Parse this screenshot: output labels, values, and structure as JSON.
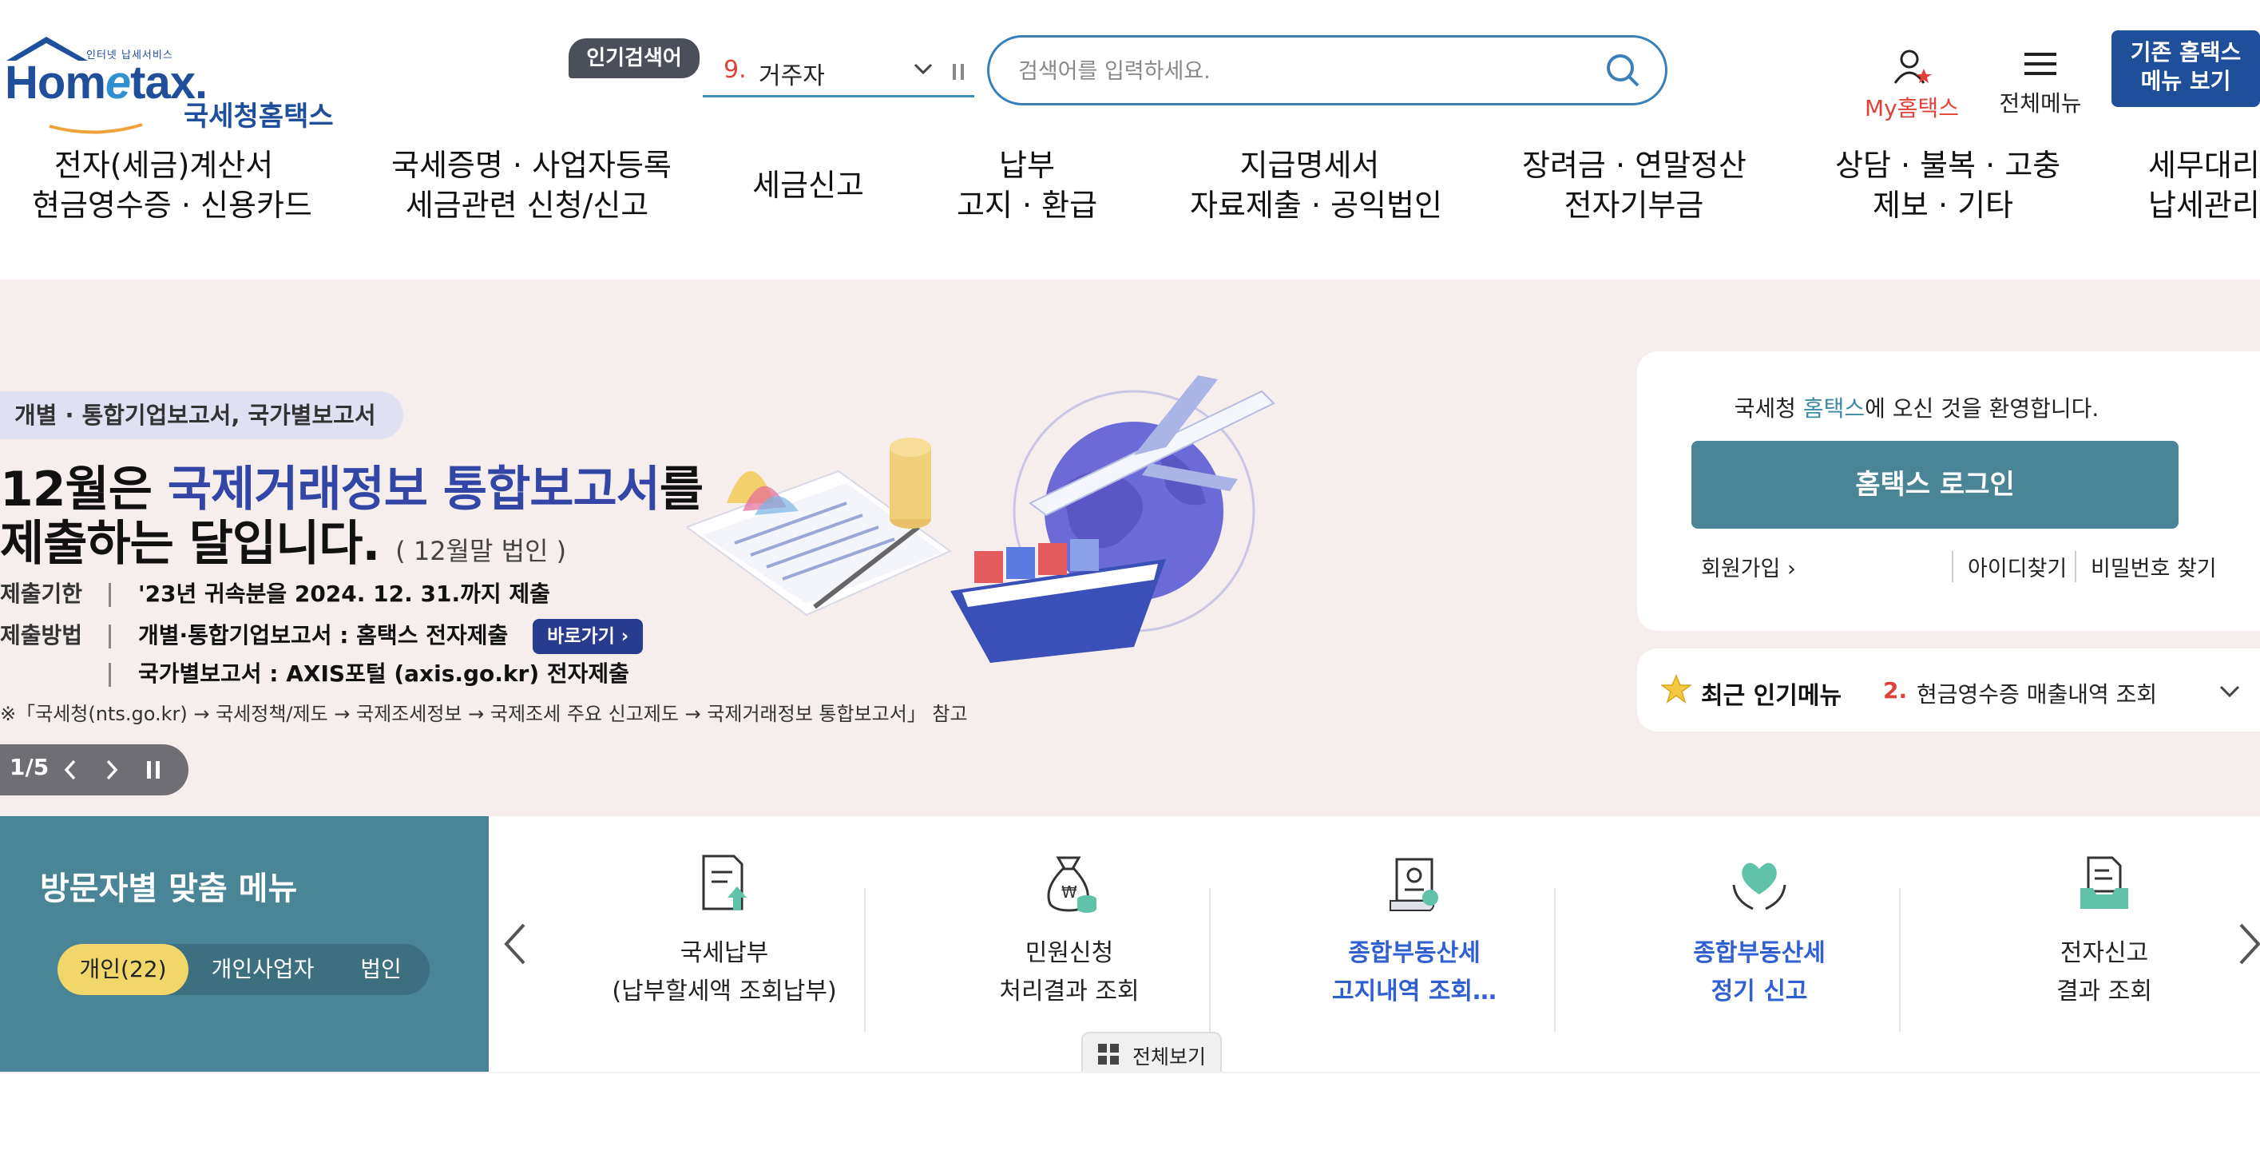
{
  "header": {
    "logo": {
      "small_text": "인터넷 납세서비스",
      "brand_prefix": "Hom",
      "brand_e": "e",
      "brand_suffix": "tax.",
      "korean_name": "국세청홈택스"
    },
    "popular_search": {
      "badge": "인기검색어",
      "rank": "9.",
      "term": "거주자"
    },
    "search": {
      "placeholder": "검색어를 입력하세요."
    },
    "my_hometax_label": "My홈택스",
    "all_menu_label": "전체메뉴",
    "legacy_menu_button": {
      "line1": "기존 홈택스",
      "line2": "메뉴 보기"
    },
    "accent_color": "#1f4e9a"
  },
  "nav": {
    "items": [
      {
        "line1": "전자(세금)계산서",
        "line2": "현금영수증 · 신용카드"
      },
      {
        "line1": "국세증명 · 사업자등록",
        "line2": "세금관련 신청/신고"
      },
      {
        "line1": "세금신고",
        "line2": ""
      },
      {
        "line1": "납부",
        "line2": "고지 · 환급"
      },
      {
        "line1": "지급명세서",
        "line2": "자료제출 · 공익법인"
      },
      {
        "line1": "장려금 · 연말정산",
        "line2": "전자기부금"
      },
      {
        "line1": "상담 · 불복 · 고충",
        "line2": "제보 · 기타"
      },
      {
        "line1": "세무대리",
        "line2": "납세관리"
      }
    ]
  },
  "banner": {
    "tag": "개별 · 통합기업보고서, 국가별보고서",
    "headline1_pre": "12월은 ",
    "headline1_hl": "국제거래정보 통합보고서",
    "headline1_post": "를",
    "headline2": "제출하는 달입니다.",
    "headline2_sub": "( 12월말 법인 )",
    "rows": [
      {
        "key": "제출기한",
        "value": "'23년 귀속분을 2024. 12. 31.까지 제출"
      },
      {
        "key": "제출방법",
        "value": "개별·통합기업보고서 : 홈택스 전자제출"
      },
      {
        "key": "",
        "value": "국가별보고서 : AXIS포털 (axis.go.kr) 전자제출"
      }
    ],
    "go_button": "바로가기",
    "note": "※「국세청(nts.go.kr) → 국세정책/제도 → 국제조세정보 → 국제조세 주요 신고제도 → 국제거래정보 통합보고서」 참고",
    "pager": {
      "current": "1",
      "total": "5",
      "text": "1/5"
    },
    "background_color": "#f5eeec"
  },
  "login": {
    "welcome_pre": "국세청 ",
    "welcome_hl": "홈택스",
    "welcome_post": "에 오신 것을 환영합니다.",
    "login_button": "홈택스 로그인",
    "signup": "회원가입",
    "find_id": "아이디찾기",
    "find_pw": "비밀번호 찾기",
    "button_color": "#4a8497"
  },
  "recent_popular": {
    "title": "최근 인기메뉴",
    "rank": "2.",
    "item": "현금영수증 매출내역 조회"
  },
  "visitor": {
    "title": "방문자별 맞춤 메뉴",
    "tabs": [
      "개인(22)",
      "개인사업자",
      "법인"
    ],
    "active_tab": 0,
    "panel_color": "#4a8497"
  },
  "quick_menu": {
    "items": [
      {
        "line1": "국세납부",
        "line2": "(납부할세액 조회납부)",
        "icon": "document-upload-icon",
        "highlight": false
      },
      {
        "line1": "민원신청",
        "line2": "처리결과 조회",
        "icon": "money-bag-icon",
        "highlight": false
      },
      {
        "line1": "종합부동산세",
        "line2": "고지내역 조회…",
        "icon": "certificate-scroll-icon",
        "highlight": true
      },
      {
        "line1": "종합부동산세",
        "line2": "정기 신고",
        "icon": "heart-hands-icon",
        "highlight": true
      },
      {
        "line1": "전자신고",
        "line2": "결과 조회",
        "icon": "document-tray-icon",
        "highlight": false
      }
    ],
    "view_all": "전체보기"
  }
}
